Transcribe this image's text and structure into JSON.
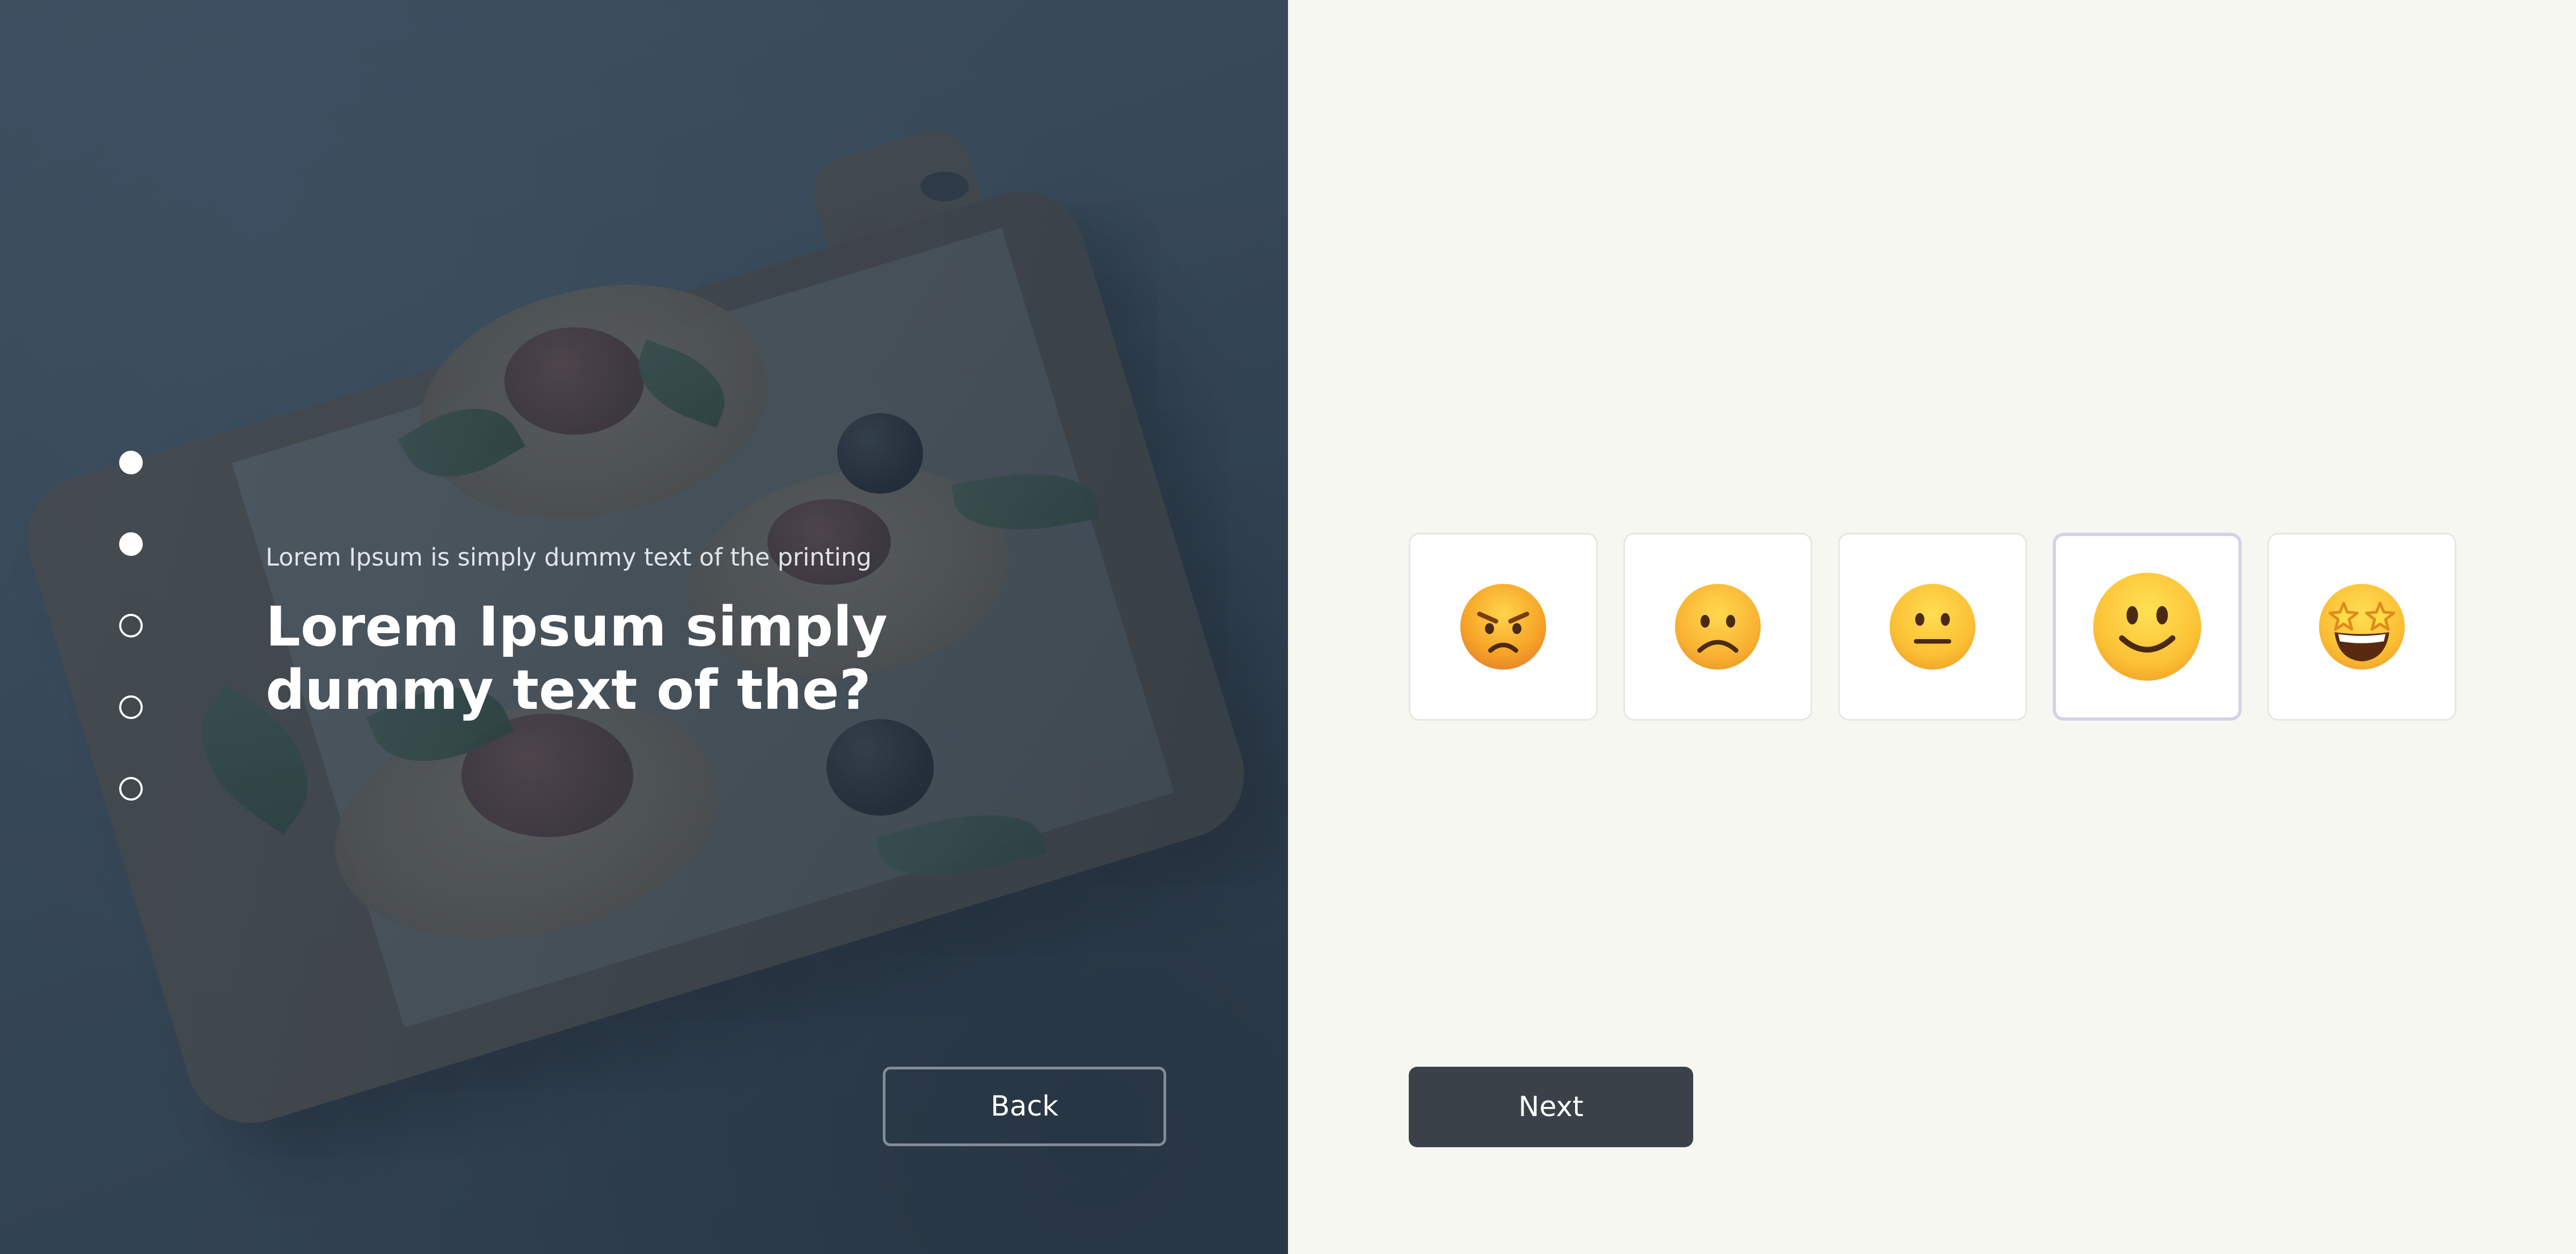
{
  "survey": {
    "subtitle": "Lorem Ipsum is simply dummy text of the printing",
    "title": "Lorem Ipsum simply dummy text of the?",
    "progress": {
      "total_steps": 5,
      "completed_steps": 2
    }
  },
  "navigation": {
    "back_label": "Back",
    "next_label": "Next"
  },
  "rating": {
    "selected_index": 3,
    "options": [
      {
        "icon": "angry-face-icon"
      },
      {
        "icon": "frowning-face-icon"
      },
      {
        "icon": "neutral-face-icon"
      },
      {
        "icon": "slightly-smiling-face-icon"
      },
      {
        "icon": "star-struck-face-icon"
      }
    ]
  },
  "colors": {
    "left_overlay": "#2c3e50",
    "right_background": "#f7f7f2",
    "next_button": "#3a4148",
    "selected_border": "#d4d2e8",
    "emoji_yellow": "#ffcc33"
  }
}
